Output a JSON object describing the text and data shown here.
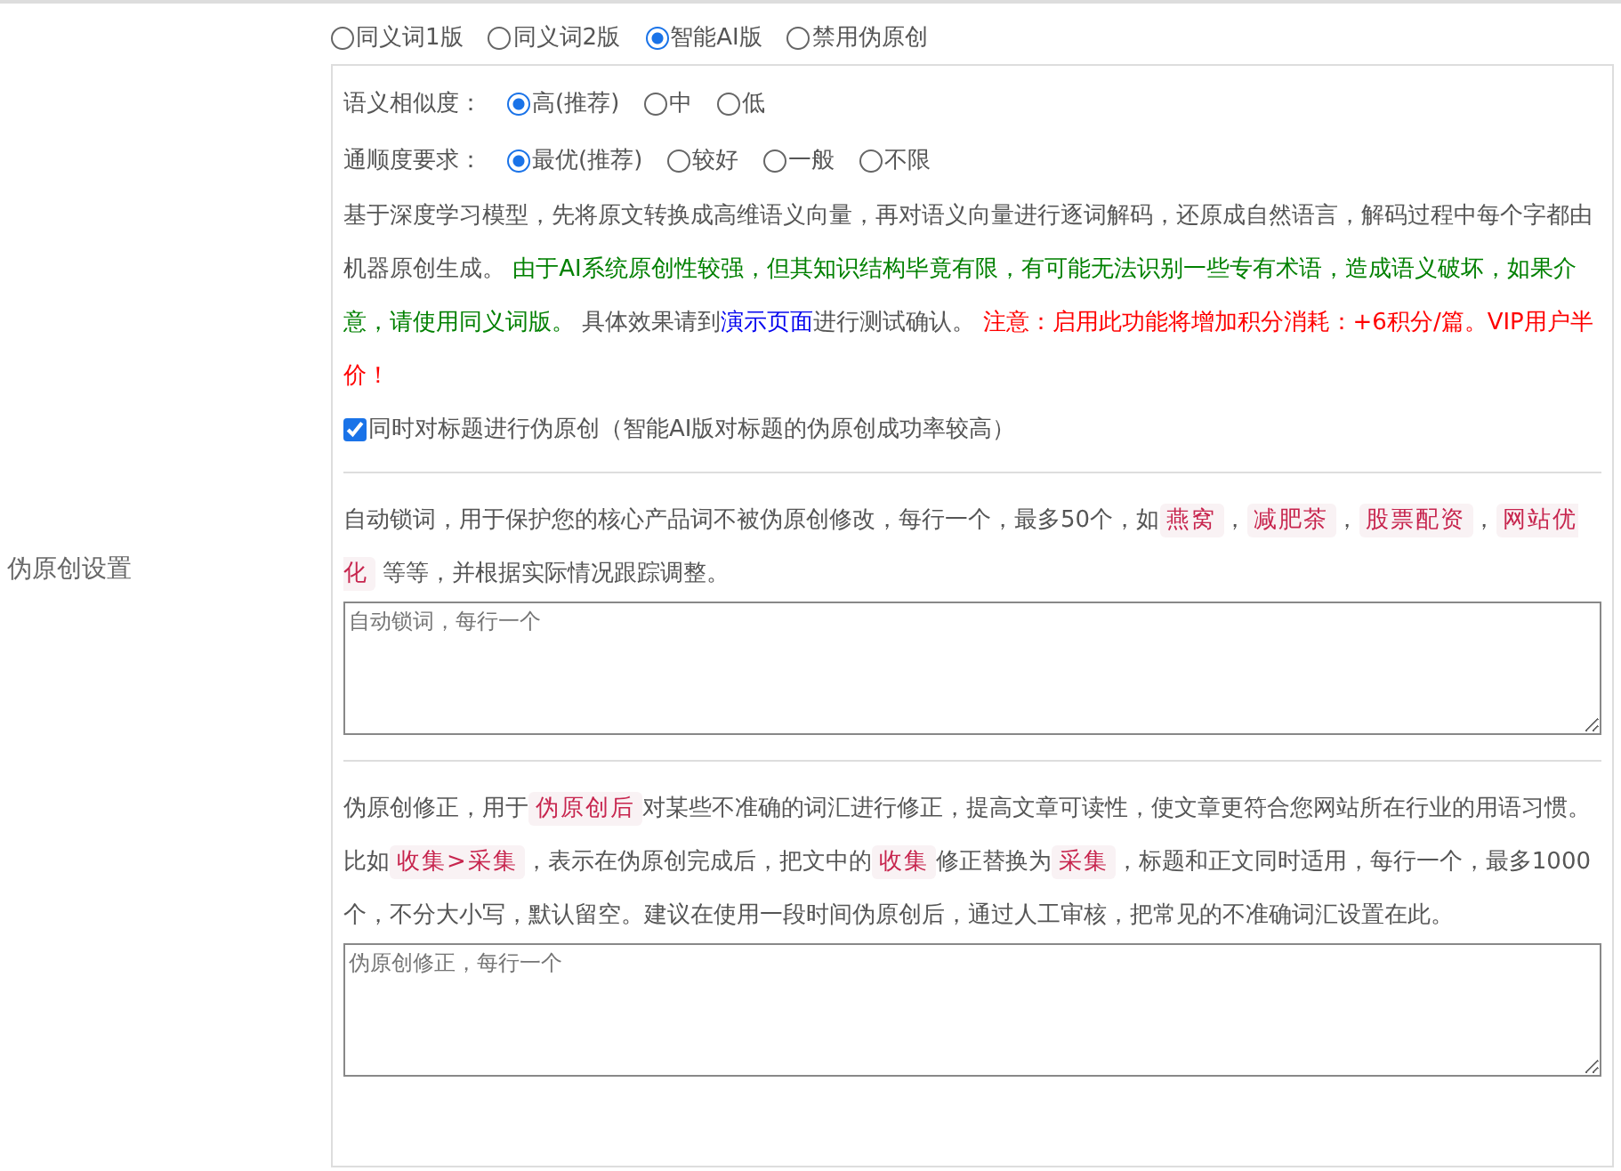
{
  "label": "伪原创设置",
  "modes": [
    {
      "label": "同义词1版",
      "selected": false
    },
    {
      "label": "同义词2版",
      "selected": false
    },
    {
      "label": "智能AI版",
      "selected": true
    },
    {
      "label": "禁用伪原创",
      "selected": false
    }
  ],
  "similarity": {
    "label": "语义相似度：",
    "options": [
      {
        "label": "高(推荐)",
        "selected": true
      },
      {
        "label": "中",
        "selected": false
      },
      {
        "label": "低",
        "selected": false
      }
    ]
  },
  "fluency": {
    "label": "通顺度要求：",
    "options": [
      {
        "label": "最优(推荐)",
        "selected": true
      },
      {
        "label": "较好",
        "selected": false
      },
      {
        "label": "一般",
        "selected": false
      },
      {
        "label": "不限",
        "selected": false
      }
    ]
  },
  "description": [
    {
      "kind": "text",
      "text": "基于深度学习模型，先将原文转换成高维语义向量，再对语义向量进行逐词解码，还原成自然语言，解码过程中每个字都由机器原创生成。 "
    },
    {
      "kind": "note",
      "text": "由于AI系统原创性较强，但其知识结构毕竟有限，有可能无法识别一些专有术语，造成语义破坏，如果介意，请使用同义词版。"
    },
    {
      "kind": "text",
      "text": " 具体效果请到"
    },
    {
      "kind": "link",
      "text": "演示页面"
    },
    {
      "kind": "text",
      "text": "进行测试确认。 "
    },
    {
      "kind": "warning",
      "text": "注意：启用此功能将增加积分消耗：+6积分/篇。VIP用户半价！"
    }
  ],
  "title_option": {
    "label": "同时对标题进行伪原创（智能AI版对标题的伪原创成功率较高）",
    "checked": true
  },
  "lock_words": {
    "segments": [
      {
        "kind": "text",
        "text": "自动锁词，用于保护您的核心产品词不被伪原创修改，每行一个，最多50个，如"
      },
      {
        "kind": "code",
        "text": "燕窝"
      },
      {
        "kind": "text",
        "text": "，"
      },
      {
        "kind": "code",
        "text": "减肥茶"
      },
      {
        "kind": "text",
        "text": "，"
      },
      {
        "kind": "code",
        "text": "股票配资"
      },
      {
        "kind": "text",
        "text": "，"
      },
      {
        "kind": "code",
        "text": "网站优化"
      },
      {
        "kind": "text",
        "text": " 等等，并根据实际情况跟踪调整。"
      }
    ],
    "placeholder": "自动锁词，每行一个"
  },
  "corrections": {
    "segments": [
      {
        "kind": "text",
        "text": "伪原创修正，用于"
      },
      {
        "kind": "code",
        "text": "伪原创后"
      },
      {
        "kind": "text",
        "text": "对某些不准确的词汇进行修正，提高文章可读性，使文章更符合您网站所在行业的用语习惯。比如"
      },
      {
        "kind": "code",
        "text": "收集>采集"
      },
      {
        "kind": "text",
        "text": "，表示在伪原创完成后，把文中的"
      },
      {
        "kind": "code",
        "text": "收集"
      },
      {
        "kind": "text",
        "text": "修正替换为"
      },
      {
        "kind": "code",
        "text": "采集"
      },
      {
        "kind": "text",
        "text": "，标题和正文同时适用，每行一个，最多1000个，不分大小写，默认留空。建议在使用一段时间伪原创后，通过人工审核，把常见的不准确词汇设置在此。"
      }
    ],
    "placeholder": "伪原创修正，每行一个"
  }
}
